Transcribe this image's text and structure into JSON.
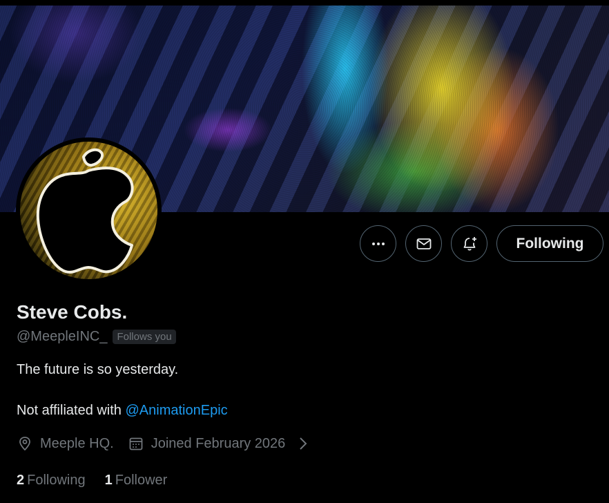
{
  "profile": {
    "name": "Steve Cobs.",
    "handle": "@MeepleINC_",
    "follows_you_badge": "Follows you",
    "bio_line1": "The future is so yesterday.",
    "bio_line2_prefix": "Not affiliated with ",
    "bio_line2_mention": "@AnimationEpic",
    "location": "Meeple HQ.",
    "joined": "Joined February 2026",
    "following_count": "2",
    "following_label": "Following",
    "followers_count": "1",
    "followers_label": "Follower"
  },
  "actions": {
    "follow_button_label": "Following",
    "more_icon": "more-horizontal-icon",
    "message_icon": "envelope-icon",
    "notify_icon": "bell-plus-icon"
  },
  "colors": {
    "background": "#000000",
    "text_primary": "#e7e9ea",
    "text_secondary": "#71767b",
    "link": "#1d9bf0",
    "border": "#536471"
  }
}
